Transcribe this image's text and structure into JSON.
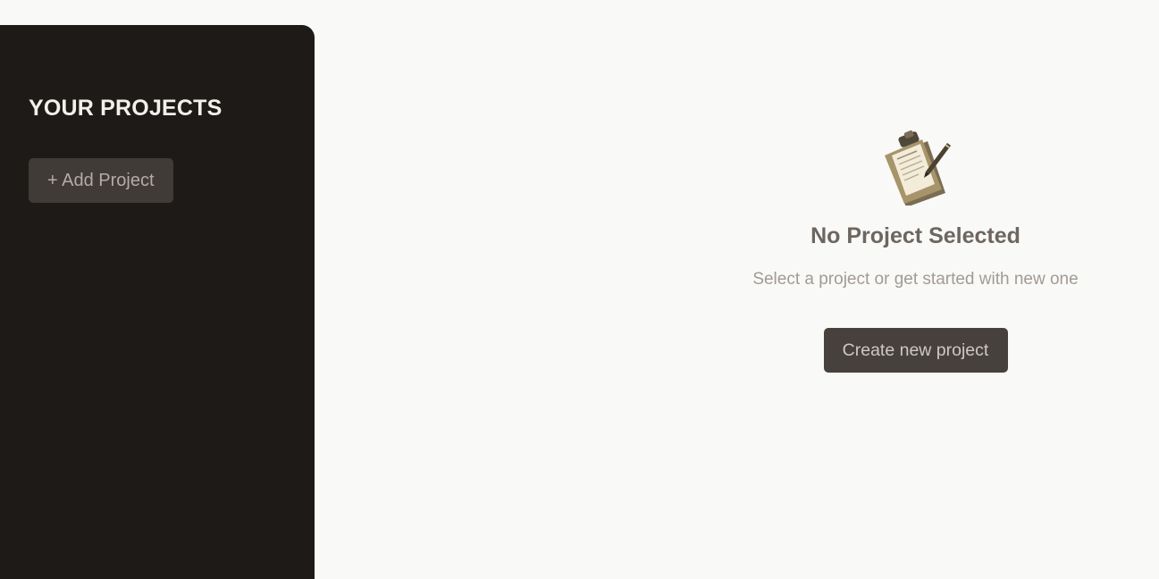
{
  "sidebar": {
    "title": "YOUR PROJECTS",
    "add_button_label": "+ Add Project"
  },
  "main": {
    "empty_state": {
      "icon": "clipboard-icon",
      "title": "No Project Selected",
      "subtitle": "Select a project or get started with new one",
      "create_button_label": "Create new project"
    }
  },
  "colors": {
    "sidebar_background": "#1e1a17",
    "page_background": "#f9f9f7",
    "button_background": "#46413d"
  }
}
